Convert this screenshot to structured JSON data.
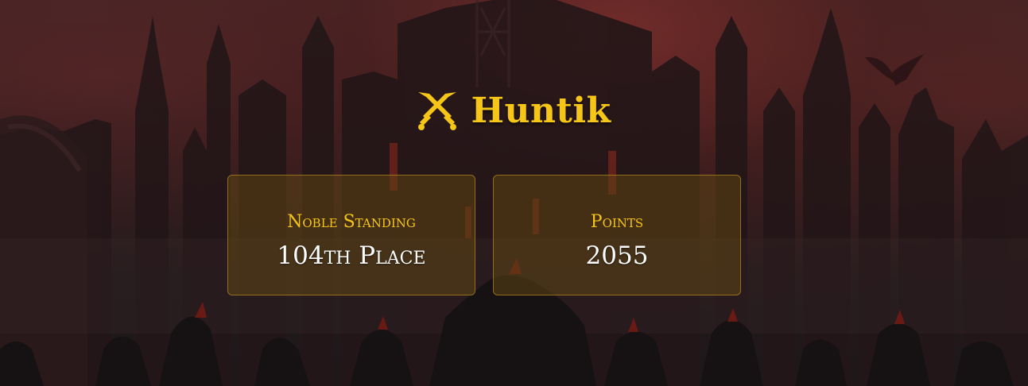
{
  "header": {
    "icon": "crossed-swords-icon",
    "name": "Huntik"
  },
  "stats": {
    "standing_label": "Noble Standing",
    "standing_value": "104th Place",
    "points_label": "Points",
    "points_value": "2055"
  },
  "colors": {
    "accent_gold": "#f5c518",
    "card_border": "#d4a028",
    "value_text": "#ffffff"
  }
}
